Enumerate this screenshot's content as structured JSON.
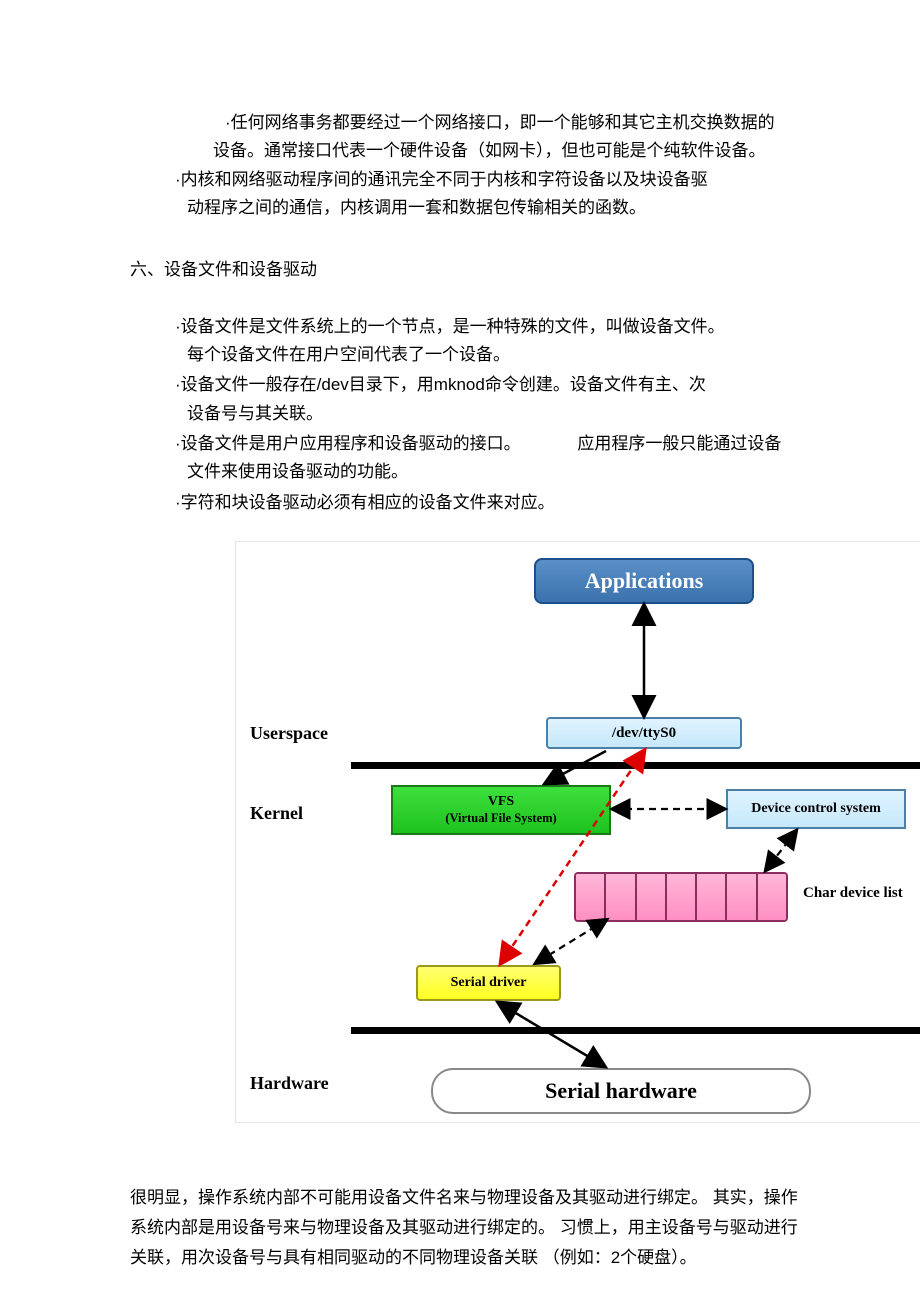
{
  "top_bullets": [
    {
      "level": 2,
      "text": "·任何网络事务都要经过一个网络接口，即一个能够和其它主机交换数据的",
      "cont_level": 2,
      "cont": "设备。通常接口代表一个硬件设备（如网卡），但也可能是个纯软件设备。"
    },
    {
      "level": 1,
      "text": "·内核和网络驱动程序间的通讯完全不同于内核和字符设备以及块设备驱",
      "cont_level": 1,
      "cont": "动程序之间的通信，内核调用一套和数据包传输相关的函数。"
    }
  ],
  "section_title": "六、设备文件和设备驱动",
  "section_bullets": [
    {
      "text": "·设备文件是文件系统上的一个节点，是一种特殊的文件，叫做设备文件。",
      "cont": "每个设备文件在用户空间代表了一个设备。"
    },
    {
      "text": "·设备文件一般存在/dev目录下，用mknod命令创建。设备文件有主、次",
      "cont": "设备号与其关联。"
    },
    {
      "text": "·设备文件是用户应用程序和设备驱动的接口。            应用程序一般只能通过设备",
      "cont": "文件来使用设备驱动的功能。"
    },
    {
      "text": "·字符和块设备驱动必须有相应的设备文件来对应。",
      "cont": ""
    }
  ],
  "diagram": {
    "userspace": "Userspace",
    "kernel": "Kernel",
    "hardware": "Hardware",
    "applications": "Applications",
    "dev_tty": "/dev/ttyS0",
    "vfs_line1": "VFS",
    "vfs_line2": "(Virtual File System)",
    "dcs": "Device control system",
    "char_list": "Char device list",
    "serial_driver": "Serial driver",
    "serial_hw": "Serial hardware"
  },
  "body_para": "很明显，操作系统内部不可能用设备文件名来与物理设备及其驱动进行绑定。 其实，操作系统内部是用设备号来与物理设备及其驱动进行绑定的。 习惯上，用主设备号与驱动进行关联，用次设备号与具有相同驱动的不同物理设备关联 （例如：2个硬盘）。"
}
